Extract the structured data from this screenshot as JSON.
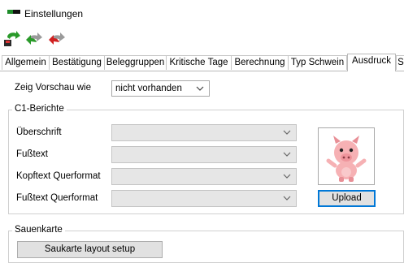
{
  "window": {
    "title": "Einstellungen"
  },
  "toolbar": {
    "buttons": [
      {
        "icon": "save-arrow-icon"
      },
      {
        "icon": "back-arrow-icon"
      },
      {
        "icon": "delete-arrow-icon"
      }
    ]
  },
  "tabs": [
    {
      "label": "Allgemein"
    },
    {
      "label": "Bestätigung"
    },
    {
      "label": "Beleggruppen"
    },
    {
      "label": "Kritische Tage"
    },
    {
      "label": "Berechnung"
    },
    {
      "label": "Typ Schwein"
    },
    {
      "label": "Ausdruck",
      "active": true
    },
    {
      "label": "S"
    }
  ],
  "preview": {
    "label": "Zeig Vorschau wie",
    "value": "nicht vorhanden"
  },
  "c1": {
    "title": "C1-Berichte",
    "fields": [
      {
        "label": "Überschrift"
      },
      {
        "label": "Fußtext"
      },
      {
        "label": "Kopftext Querformat"
      },
      {
        "label": "Fußtext Querformat"
      }
    ],
    "upload_label": "Upload",
    "image_icon": "pig-icon"
  },
  "sauenkarte": {
    "title": "Sauenkarte",
    "button_label": "Saukarte layout setup"
  },
  "colors": {
    "accent": "#0078d7",
    "tab_border": "#b9b9b9",
    "disabled_field": "#e6e6e6",
    "button_face": "#e1e1e1"
  }
}
